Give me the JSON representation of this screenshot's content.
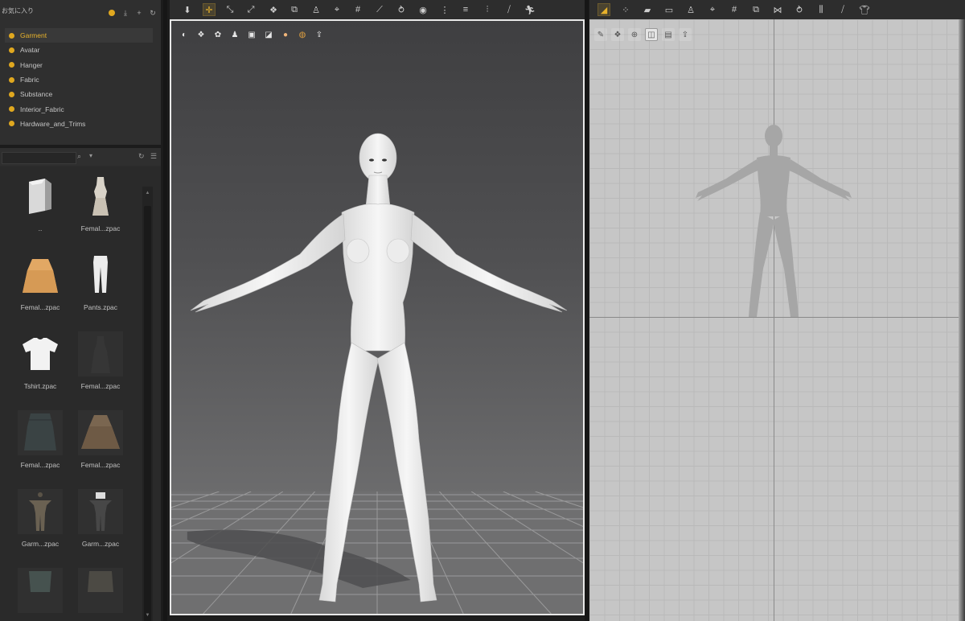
{
  "favorites": {
    "title": "お気に入り",
    "items": [
      {
        "label": "Garment",
        "active": true
      },
      {
        "label": "Avatar",
        "active": false
      },
      {
        "label": "Hanger",
        "active": false
      },
      {
        "label": "Fabric",
        "active": false
      },
      {
        "label": "Substance",
        "active": false
      },
      {
        "label": "Interior_Fabric",
        "active": false
      },
      {
        "label": "Hardware_and_Trims",
        "active": false
      }
    ]
  },
  "library": {
    "search_placeholder": "",
    "items": [
      {
        "label": "..",
        "thumb": "folder-up"
      },
      {
        "label": "Femal...zpac",
        "thumb": "dress"
      },
      {
        "label": "Femal...zpac",
        "thumb": "skirt-orange"
      },
      {
        "label": "Pants.zpac",
        "thumb": "pants"
      },
      {
        "label": "Tshirt.zpac",
        "thumb": "tshirt"
      },
      {
        "label": "Femal...zpac",
        "thumb": "dark-dress"
      },
      {
        "label": "Femal...zpac",
        "thumb": "dark-skirt"
      },
      {
        "label": "Femal...zpac",
        "thumb": "brown-skirt"
      },
      {
        "label": "Garm...zpac",
        "thumb": "avatar-garment"
      },
      {
        "label": "Garm...zpac",
        "thumb": "avatar-garment-dark"
      },
      {
        "label": "",
        "thumb": "partial-top"
      },
      {
        "label": "",
        "thumb": "partial-skirt"
      }
    ]
  },
  "colors": {
    "accent": "#e8b22b",
    "panel_bg": "#2b2b2b",
    "view3d_border": "#e8e8e8",
    "view2d_bg": "#c6c6c6"
  }
}
